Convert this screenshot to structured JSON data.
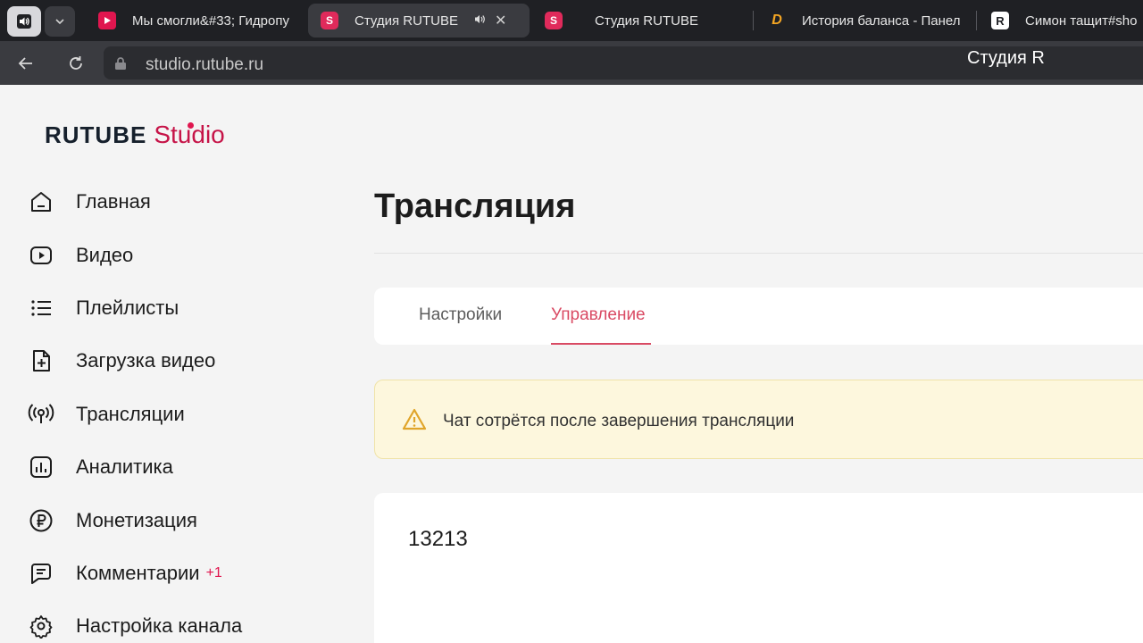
{
  "browser": {
    "tabs": [
      {
        "title": "Мы смогли&#33; Гидропу",
        "favicon": "youtube-play-icon",
        "active": false
      },
      {
        "title": "Студия RUTUBE",
        "favicon": "rutube-studio-icon",
        "active": true
      },
      {
        "title": "Студия RUTUBE",
        "favicon": "rutube-studio-icon",
        "active": false
      },
      {
        "title": "История баланса - Панел",
        "favicon": "donation-d-icon",
        "active": false
      },
      {
        "title": "Симон тащит#sho",
        "favicon": "rutube-r-icon",
        "active": false
      }
    ],
    "url": "studio.rutube.ru",
    "page_title": "Студия R"
  },
  "logo": {
    "brand": "RUTUBE",
    "product": "Studio"
  },
  "sidebar": {
    "items": [
      {
        "label": "Главная",
        "icon": "home-icon"
      },
      {
        "label": "Видео",
        "icon": "video-play-icon"
      },
      {
        "label": "Плейлисты",
        "icon": "list-icon"
      },
      {
        "label": "Загрузка видео",
        "icon": "file-plus-icon"
      },
      {
        "label": "Трансляции",
        "icon": "broadcast-icon"
      },
      {
        "label": "Аналитика",
        "icon": "bar-chart-icon"
      },
      {
        "label": "Монетизация",
        "icon": "ruble-icon"
      },
      {
        "label": "Комментарии",
        "icon": "comment-icon",
        "badge": "+1"
      },
      {
        "label": "Настройка канала",
        "icon": "gear-icon"
      }
    ]
  },
  "main": {
    "title": "Трансляция",
    "tabs": [
      {
        "label": "Настройки",
        "active": false
      },
      {
        "label": "Управление",
        "active": true
      }
    ],
    "warning": "Чат сотрётся после завершения трансляции",
    "content_value": "13213"
  },
  "colors": {
    "accent": "#d94a63",
    "brand": "#e0164f",
    "warning_bg": "#fdf7dd"
  }
}
